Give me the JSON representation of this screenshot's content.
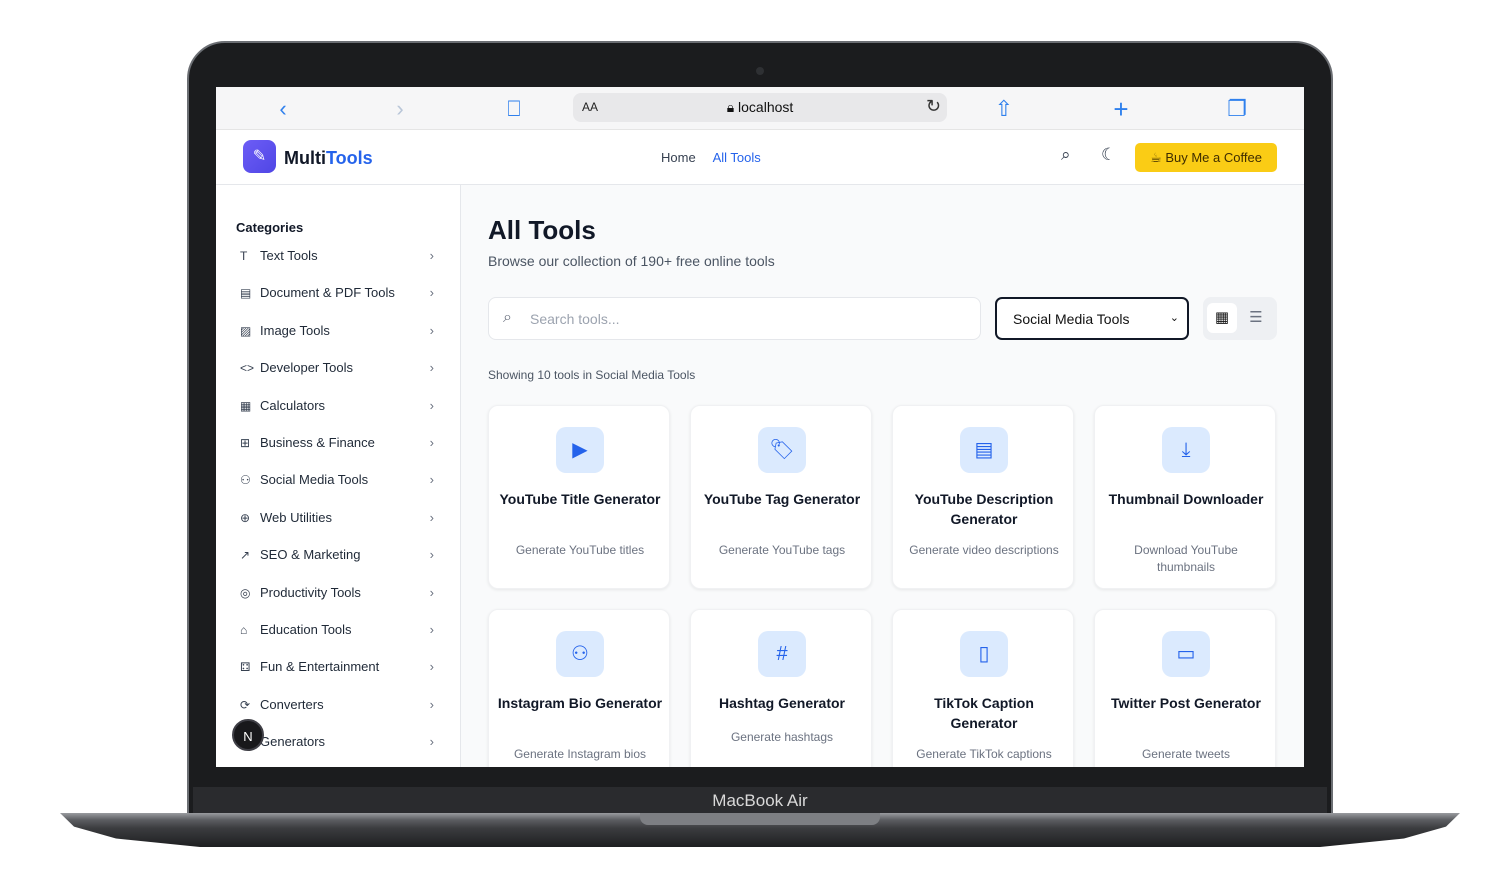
{
  "device": {
    "label": "MacBook Air"
  },
  "browser": {
    "aa_label": "AA",
    "url": "localhost",
    "back": "‹",
    "forward": "›",
    "reload": "↻",
    "bookmarks": "⎕",
    "share": "⇧",
    "new_tab": "+",
    "tabs": "❐"
  },
  "header": {
    "brand_main": "Multi",
    "brand_accent": "Tools",
    "nav": [
      "Home",
      "All Tools"
    ],
    "coffee_button": "Buy Me a Coffee"
  },
  "sidebar": {
    "title": "Categories",
    "items": [
      {
        "label": "Text Tools",
        "icon": "T"
      },
      {
        "label": "Document & PDF Tools",
        "icon": "▤"
      },
      {
        "label": "Image Tools",
        "icon": "▨"
      },
      {
        "label": "Developer Tools",
        "icon": "<>"
      },
      {
        "label": "Calculators",
        "icon": "▦"
      },
      {
        "label": "Business & Finance",
        "icon": "⊞"
      },
      {
        "label": "Social Media Tools",
        "icon": "⚇"
      },
      {
        "label": "Web Utilities",
        "icon": "⊕"
      },
      {
        "label": "SEO & Marketing",
        "icon": "↗"
      },
      {
        "label": "Productivity Tools",
        "icon": "◎"
      },
      {
        "label": "Education Tools",
        "icon": "⌂"
      },
      {
        "label": "Fun & Entertainment",
        "icon": "⚃"
      },
      {
        "label": "Converters",
        "icon": "⟳"
      },
      {
        "label": "Generators",
        "icon": "✦"
      }
    ],
    "badge": "N"
  },
  "main": {
    "title": "All Tools",
    "subtitle": "Browse our collection of 190+ free online tools",
    "search_placeholder": "Search tools...",
    "category_select": "Social Media Tools",
    "count_text": "Showing 10 tools in Social Media Tools",
    "tools": [
      {
        "title": "YouTube Title Generator",
        "desc": "Generate YouTube titles",
        "icon": "▶"
      },
      {
        "title": "YouTube Tag Generator",
        "desc": "Generate YouTube tags",
        "icon": "🏷"
      },
      {
        "title": "YouTube Description Generator",
        "desc": "Generate video descriptions",
        "icon": "▤"
      },
      {
        "title": "Thumbnail Downloader",
        "desc": "Download YouTube thumbnails",
        "icon": "⤓"
      },
      {
        "title": "Instagram Bio Generator",
        "desc": "Generate Instagram bios",
        "icon": "⚇"
      },
      {
        "title": "Hashtag Generator",
        "desc": "Generate hashtags",
        "icon": "#"
      },
      {
        "title": "TikTok Caption Generator",
        "desc": "Generate TikTok captions",
        "icon": "▯"
      },
      {
        "title": "Twitter Post Generator",
        "desc": "Generate tweets",
        "icon": "▭"
      }
    ]
  }
}
